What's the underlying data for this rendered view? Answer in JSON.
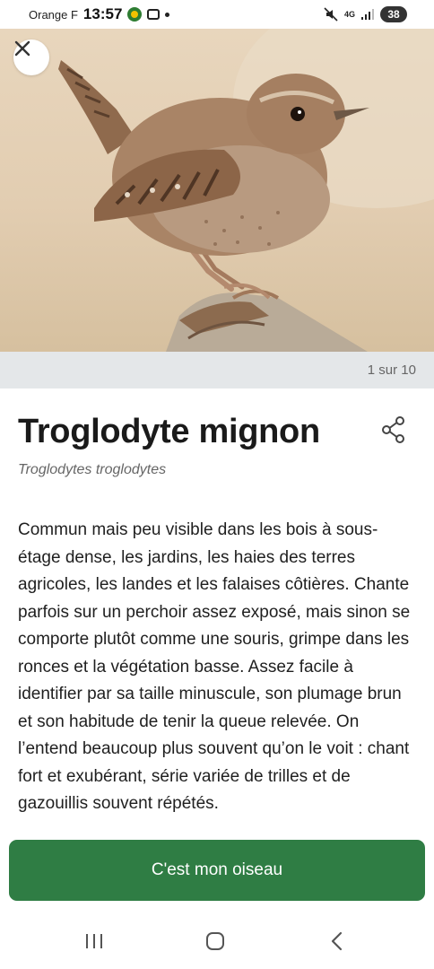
{
  "status_bar": {
    "carrier": "Orange F",
    "time": "13:57",
    "network": "4G",
    "battery": "38"
  },
  "viewer": {
    "counter": "1 sur 10"
  },
  "bird": {
    "common_name": "Troglodyte mignon",
    "scientific_name": "Troglodytes troglodytes",
    "description": "Commun mais peu visible dans les bois à sous-étage dense, les jardins, les haies des terres agricoles, les landes et les falaises côtières. Chante parfois sur un perchoir assez exposé, mais sinon se comporte plutôt comme une souris, grimpe dans les ronces et la végétation basse. Assez facile à identifier par sa taille minuscule, son plumage brun et son habitude de tenir la queue relevée. On l’entend beaucoup plus souvent qu’on le voit : chant fort et exubérant, série variée de trilles et de gazouillis souvent répétés."
  },
  "actions": {
    "confirm_label": "C'est mon oiseau"
  },
  "icons": {
    "close": "close-icon",
    "share": "share-icon",
    "recents": "recents-icon",
    "home": "home-icon",
    "back": "back-icon"
  },
  "colors": {
    "primary_green": "#2f7d44",
    "strip_gray": "#e4e7e9"
  }
}
